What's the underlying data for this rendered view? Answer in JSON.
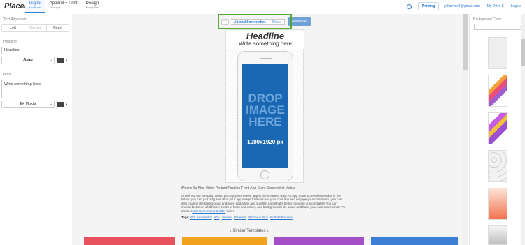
{
  "header": {
    "logo": "Placeit",
    "nav": [
      {
        "label": "Digital",
        "sub": "Mockups"
      },
      {
        "label": "Apparel + Print",
        "sub": "Mockups"
      },
      {
        "label": "Design",
        "sub": "Templates"
      }
    ],
    "pricing": "Pricing",
    "email": "juliaevan1@gmail.com",
    "my_drive": "My Drive",
    "drive_count": "8",
    "logout": "Logout"
  },
  "sidebar": {
    "text_alignment_label": "Text Alignment",
    "alignment": [
      "Left",
      "Center",
      "Right"
    ],
    "heading_label": "Heading",
    "heading_value": "Headline",
    "heading_font": "Asap",
    "body_label": "Body",
    "body_value": "Write something here",
    "body_font": "Ek Mukta"
  },
  "toolbar": {
    "upload": "Upload Screenshot",
    "share": "Share",
    "download": "Download"
  },
  "mockup": {
    "headline": "Headline",
    "subline": "Write something here",
    "drop_lines": [
      "DROP",
      "IMAGE",
      "HERE"
    ],
    "dims": "1080x1920 px"
  },
  "description": {
    "title": "iPhone 6s Plus White Portrait Position Front App Store Screenshot Maker",
    "body": "Check out our amazing tool to portray your newest app in the smartest way! An App Store Screenshot Maker is the future, you can just drag and drop your app image to showcase your cool app and engage your customers, you can also change the background and even add a title and subtitle! And what's better, they are customizable! You can choose between all different kinds of fonts and colors, and backgrounds! Be smart and build your own screenshot! Try another",
    "body_link": "iOS Screenshot Builder",
    "body_end": "here!",
    "tags_label": "Tags:",
    "tags": [
      "iOS screenshot",
      "iOS",
      "iPhone",
      "iPhone 6",
      "iPhone 6 Plus",
      "Portrait Position"
    ],
    "similar": "↓ Similar Templates ↓"
  },
  "similar_cards": [
    {
      "color": "#e8525e"
    },
    {
      "color": "#f2a31c"
    },
    {
      "color": "#a44fc7"
    },
    {
      "color": "#3d7fd6"
    }
  ],
  "right_panel": {
    "label": "Background Color",
    "tiles": [
      {
        "style": "plain"
      },
      {
        "style": "triangles-warm"
      },
      {
        "style": "triangles-purple"
      },
      {
        "style": "icons-grey"
      },
      {
        "style": "gradient-coral"
      },
      {
        "style": "gradient-grey"
      }
    ]
  }
}
